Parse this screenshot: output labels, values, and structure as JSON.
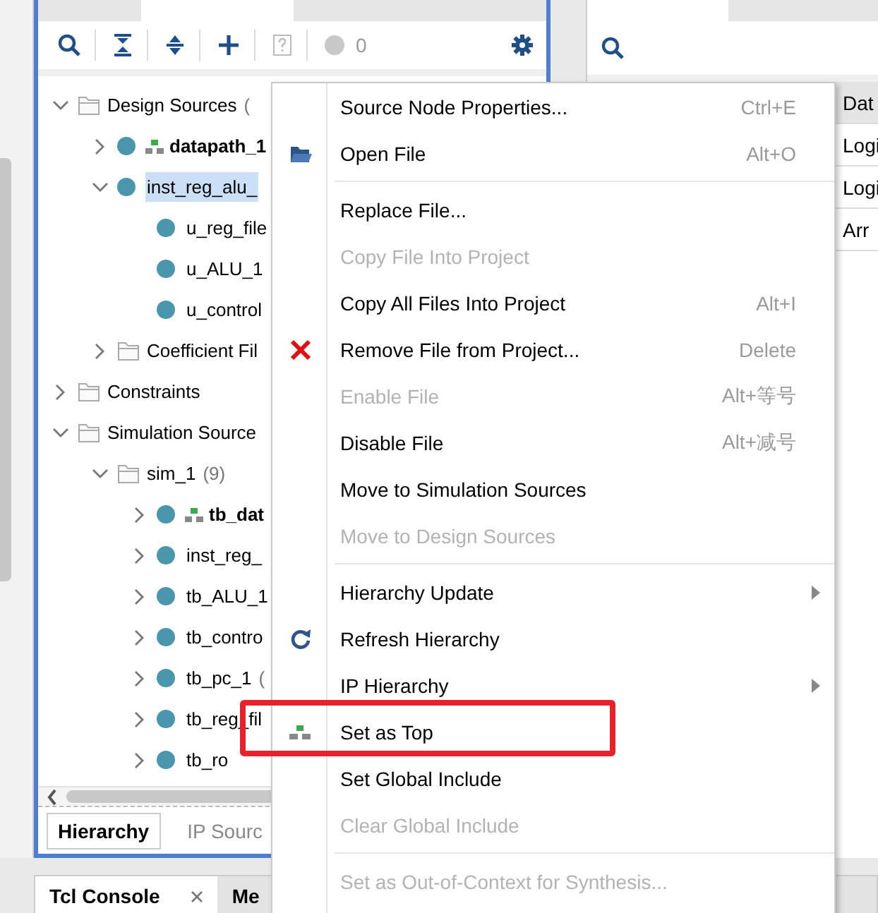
{
  "hierarchy_panel": {
    "toolbar": {
      "issue_count": "0"
    },
    "tree": [
      {
        "label": "Design Sources",
        "count": "(",
        "kind": "folder",
        "expanded": true,
        "selected": false,
        "top": false,
        "children": [
          {
            "label": "datapath_1",
            "kind": "module",
            "expanded": false,
            "selected": false,
            "top": true
          },
          {
            "label": "inst_reg_alu_",
            "kind": "module",
            "expanded": true,
            "selected": true,
            "top": false,
            "children": [
              {
                "label": "u_reg_file",
                "kind": "leaf",
                "selected": false,
                "top": false
              },
              {
                "label": "u_ALU_1",
                "kind": "leaf",
                "selected": false,
                "top": false
              },
              {
                "label": "u_control",
                "kind": "leaf",
                "selected": false,
                "top": false
              }
            ]
          },
          {
            "label": "Coefficient Fil",
            "kind": "folder",
            "expanded": false,
            "selected": false,
            "top": false
          }
        ]
      },
      {
        "label": "Constraints",
        "kind": "folder",
        "expanded": false,
        "selected": false,
        "top": false
      },
      {
        "label": "Simulation Source",
        "kind": "folder",
        "expanded": true,
        "selected": false,
        "top": false,
        "children": [
          {
            "label": "sim_1",
            "count": "(9)",
            "kind": "folder",
            "expanded": true,
            "selected": false,
            "top": false,
            "children": [
              {
                "label": "tb_dat",
                "kind": "module",
                "expanded": false,
                "selected": false,
                "top": true
              },
              {
                "label": "inst_reg_",
                "kind": "module",
                "expanded": false,
                "selected": false,
                "top": false
              },
              {
                "label": "tb_ALU_1",
                "kind": "module",
                "expanded": false,
                "selected": false,
                "top": false
              },
              {
                "label": "tb_contro",
                "kind": "module",
                "expanded": false,
                "selected": false,
                "top": false
              },
              {
                "label": "tb_pc_1",
                "count": "(",
                "kind": "module",
                "expanded": false,
                "selected": false,
                "top": false
              },
              {
                "label": "tb_reg_fil",
                "kind": "module",
                "expanded": false,
                "selected": false,
                "top": false
              },
              {
                "label": "tb_ro",
                "kind": "module",
                "expanded": false,
                "selected": false,
                "top": false
              }
            ]
          }
        ]
      }
    ],
    "bottom_tabs": [
      {
        "label": "Hierarchy",
        "selected": true
      },
      {
        "label": "IP Sourc",
        "selected": false
      }
    ]
  },
  "right_panel": {
    "cells": [
      "Dat",
      "Logi",
      "Logi",
      "Arr"
    ]
  },
  "context_menu": {
    "items": [
      {
        "kind": "item",
        "label": "Source Node Properties...",
        "shortcut": "Ctrl+E",
        "disabled": false,
        "submenu": false,
        "annotated": false
      },
      {
        "kind": "item",
        "label": "Open File",
        "shortcut": "Alt+O",
        "disabled": false,
        "submenu": false,
        "annotated": false
      },
      {
        "kind": "separator"
      },
      {
        "kind": "item",
        "label": "Replace File...",
        "disabled": false,
        "submenu": false,
        "annotated": false
      },
      {
        "kind": "item",
        "label": "Copy File Into Project",
        "disabled": true,
        "submenu": false,
        "annotated": false
      },
      {
        "kind": "item",
        "label": "Copy All Files Into Project",
        "shortcut": "Alt+I",
        "disabled": false,
        "submenu": false,
        "annotated": false
      },
      {
        "kind": "item",
        "label": "Remove File from Project...",
        "shortcut": "Delete",
        "disabled": false,
        "submenu": false,
        "annotated": false
      },
      {
        "kind": "item",
        "label": "Enable File",
        "shortcut": "Alt+等号",
        "disabled": true,
        "submenu": false,
        "annotated": false
      },
      {
        "kind": "item",
        "label": "Disable File",
        "shortcut": "Alt+减号",
        "disabled": false,
        "submenu": false,
        "annotated": false
      },
      {
        "kind": "item",
        "label": "Move to Simulation Sources",
        "disabled": false,
        "submenu": false,
        "annotated": false
      },
      {
        "kind": "item",
        "label": "Move to Design Sources",
        "disabled": true,
        "submenu": false,
        "annotated": false
      },
      {
        "kind": "separator"
      },
      {
        "kind": "item",
        "label": "Hierarchy Update",
        "disabled": false,
        "submenu": true,
        "annotated": false
      },
      {
        "kind": "item",
        "label": "Refresh Hierarchy",
        "disabled": false,
        "submenu": false,
        "annotated": false
      },
      {
        "kind": "item",
        "label": "IP Hierarchy",
        "disabled": false,
        "submenu": true,
        "annotated": false
      },
      {
        "kind": "item",
        "label": "Set as Top",
        "disabled": false,
        "submenu": false,
        "annotated": true
      },
      {
        "kind": "item",
        "label": "Set Global Include",
        "disabled": false,
        "submenu": false,
        "annotated": false
      },
      {
        "kind": "item",
        "label": "Clear Global Include",
        "disabled": true,
        "submenu": false,
        "annotated": false
      },
      {
        "kind": "separator"
      },
      {
        "kind": "item",
        "label": "Set as Out-of-Context for Synthesis...",
        "disabled": true,
        "submenu": false,
        "annotated": false
      }
    ]
  },
  "annotation": {
    "color": "#e8212b"
  },
  "console_tabs": [
    {
      "label": "Tcl Console",
      "selected": true,
      "closable": true
    },
    {
      "label": "Me",
      "selected": false,
      "closable": false
    }
  ]
}
